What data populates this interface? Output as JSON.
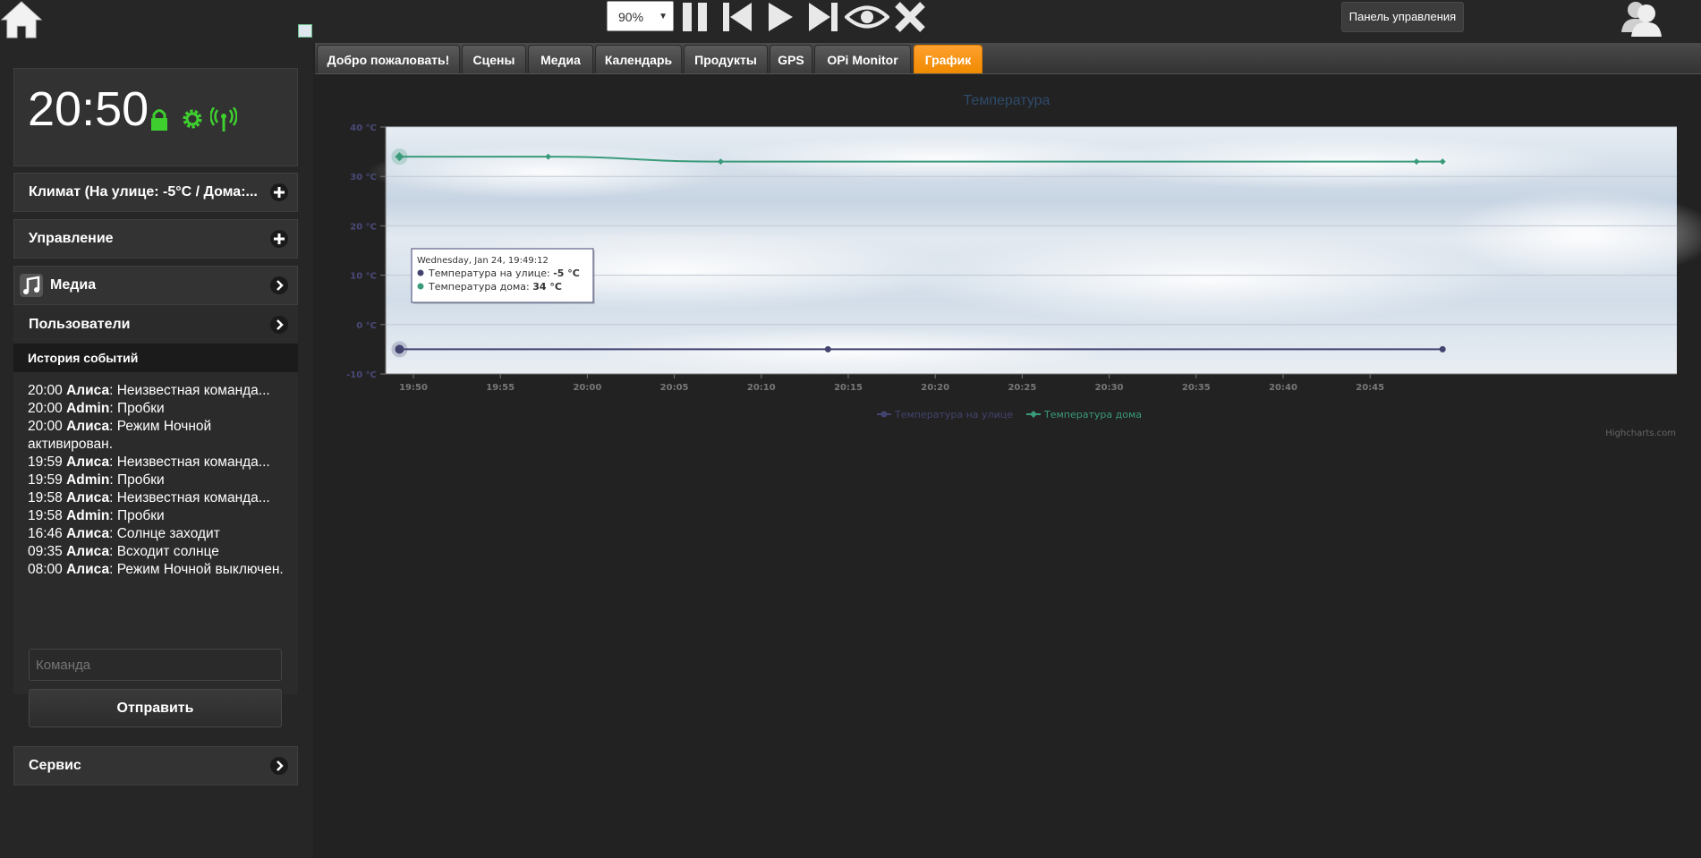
{
  "topbar": {
    "zoom": "90%",
    "control_panel_label": "Панель управления"
  },
  "sidebar": {
    "clock": "20:50",
    "accordion": [
      {
        "label": "Климат (На улице: -5°C / Дома:..."
      },
      {
        "label": "Управление"
      },
      {
        "label": "Медиа"
      },
      {
        "label": "Пользователи"
      }
    ],
    "history_title": "История событий",
    "history": [
      {
        "time": "20:00",
        "who": "Алиса",
        "text": ": Неизвестная команда..."
      },
      {
        "time": "20:00",
        "who": "Admin",
        "text": ": Пробки"
      },
      {
        "time": "20:00",
        "who": "Алиса",
        "text": ": Режим Ночной активирован."
      },
      {
        "time": "19:59",
        "who": "Алиса",
        "text": ": Неизвестная команда..."
      },
      {
        "time": "19:59",
        "who": "Admin",
        "text": ": Пробки"
      },
      {
        "time": "19:58",
        "who": "Алиса",
        "text": ": Неизвестная команда..."
      },
      {
        "time": "19:58",
        "who": "Admin",
        "text": ": Пробки"
      },
      {
        "time": "16:46",
        "who": "Алиса",
        "text": ": Солнце заходит"
      },
      {
        "time": "09:35",
        "who": "Алиса",
        "text": ": Всходит солнце"
      },
      {
        "time": "08:00",
        "who": "Алиса",
        "text": ": Режим Ночной выключен."
      }
    ],
    "command_placeholder": "Команда",
    "send_label": "Отправить",
    "service_label": "Сервис"
  },
  "tabs": [
    {
      "label": "Добро пожаловать!",
      "active": false
    },
    {
      "label": "Сцены",
      "active": false
    },
    {
      "label": "Медиа",
      "active": false
    },
    {
      "label": "Календарь",
      "active": false
    },
    {
      "label": "Продукты",
      "active": false
    },
    {
      "label": "GPS",
      "active": false
    },
    {
      "label": "OPi Monitor",
      "active": false
    },
    {
      "label": "График",
      "active": true
    }
  ],
  "chart_data": {
    "type": "line",
    "title": "Температура",
    "ylim": [
      -10,
      40
    ],
    "yticks": [
      -10,
      0,
      10,
      20,
      30,
      40
    ],
    "ytick_unit": "°C",
    "xticks": [
      "19:50",
      "19:55",
      "20:00",
      "20:05",
      "20:10",
      "20:15",
      "20:20",
      "20:25",
      "20:30",
      "20:35",
      "20:40",
      "20:45"
    ],
    "series": [
      {
        "name": "Температура на улице",
        "color": "#434370",
        "points": [
          [
            "19:49:12",
            -5
          ],
          [
            "20:13:50",
            -5
          ],
          [
            "20:49:10",
            -5
          ]
        ]
      },
      {
        "name": "Температура дома",
        "color": "#3a9b7b",
        "points": [
          [
            "19:49:12",
            34
          ],
          [
            "19:57:45",
            34
          ],
          [
            "20:07:40",
            33
          ],
          [
            "20:47:40",
            33
          ],
          [
            "20:49:10",
            33
          ]
        ]
      }
    ],
    "tooltip": {
      "header": "Wednesday, Jan 24, 19:49:12",
      "lines": [
        {
          "label": "Температура на улице: ",
          "value": "-5 °C"
        },
        {
          "label": "Температура дома: ",
          "value": "34 °C"
        }
      ]
    },
    "legend_position": "bottom-center",
    "credits": "Highcharts.com",
    "grid": true
  }
}
